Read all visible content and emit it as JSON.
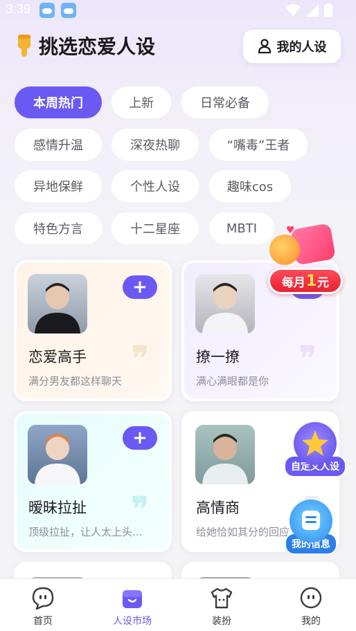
{
  "status_bar": {
    "time": "3:39"
  },
  "header": {
    "title": "挑选恋爱人设",
    "my_persona_label": "我的人设"
  },
  "categories": [
    "本周热门",
    "上新",
    "日常必备",
    "感情升温",
    "深夜热聊",
    "“嘴毒”王者",
    "异地保鲜",
    "个性人设",
    "趣味cos",
    "特色方言",
    "十二星座",
    "MBTI"
  ],
  "active_category": "本周热门",
  "promo": {
    "prefix": "每月",
    "number": "1",
    "suffix": "元"
  },
  "cards": [
    {
      "name": "恋爱高手",
      "desc": "满分男友都这样聊天",
      "add": "+"
    },
    {
      "name": "撩一撩",
      "desc": "满心满眼都是你",
      "add": "+"
    },
    {
      "name": "暧昧拉扯",
      "desc": "顶级拉扯，让人太上头...",
      "add": "+"
    },
    {
      "name": "高情商",
      "desc": "给她恰如其分的回应",
      "add": "+"
    }
  ],
  "floating": {
    "custom_persona": "自定义人设",
    "my_info": "我的信息"
  },
  "tabbar": {
    "items": [
      "首页",
      "人设市场",
      "装扮",
      "我的"
    ],
    "active": "人设市场"
  },
  "colors": {
    "accent": "#6a59f3",
    "promo_red": "#e8222f"
  }
}
